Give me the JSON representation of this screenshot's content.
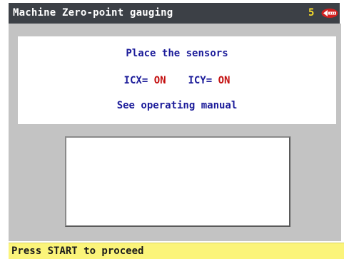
{
  "title_bar": {
    "title": "Machine Zero-point gauging",
    "number": "5",
    "logo": "brand-logo-icon"
  },
  "message": {
    "line1": "Place the sensors",
    "icx_label": "ICX=",
    "icx_value": "ON",
    "icy_label": "ICY=",
    "icy_value": "ON",
    "line3": "See operating manual"
  },
  "display_box": {
    "value": ""
  },
  "status_bar": {
    "text": "Press START to proceed"
  },
  "colors": {
    "title_bg": "#3c4046",
    "title_number": "#f7dc2c",
    "work_area_bg": "#c3c3c3",
    "message_text": "#1c1c9a",
    "sensor_on": "#c41010",
    "status_bg": "#fbf47a",
    "logo_red": "#d22020"
  }
}
